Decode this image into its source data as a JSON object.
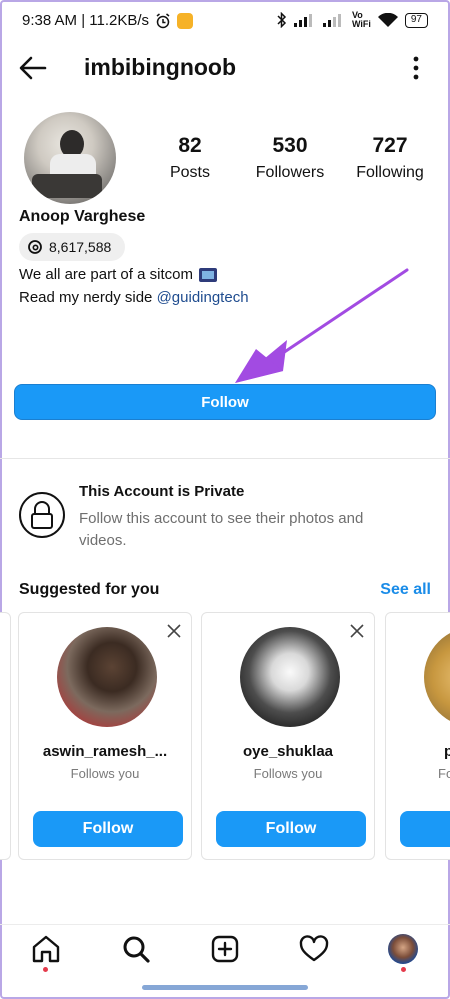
{
  "status_bar": {
    "time_speed": "9:38 AM | 11.2KB/s",
    "vo_top": "Vo",
    "vo_bottom": "WiFi",
    "battery": "97"
  },
  "header": {
    "username": "imbibingnoob"
  },
  "profile": {
    "stats": [
      {
        "value": "82",
        "label": "Posts"
      },
      {
        "value": "530",
        "label": "Followers"
      },
      {
        "value": "727",
        "label": "Following"
      }
    ],
    "full_name": "Anoop Varghese",
    "threads_count": "8,617,588",
    "bio_line1": "We all are part of a sitcom",
    "bio_line2_prefix": "Read my nerdy side",
    "bio_link": "@guidingtech",
    "follow_label": "Follow"
  },
  "private_notice": {
    "title": "This Account is Private",
    "description": "Follow this account to see their photos and videos."
  },
  "suggested": {
    "title": "Suggested for you",
    "see_all": "See all",
    "cards": [
      {
        "name": "aswin_ramesh_...",
        "subtitle": "Follows you",
        "button": "Follow"
      },
      {
        "name": "oye_shuklaa",
        "subtitle": "Follows you",
        "button": "Follow"
      },
      {
        "name": "p",
        "subtitle": "Fo",
        "button": ""
      }
    ]
  },
  "colors": {
    "accent_blue": "#1a99f7",
    "link_blue": "#1f4c8f",
    "arrow_purple": "#a24be2",
    "notification_dot": "#e43a4b"
  },
  "icons": [
    "back-arrow-icon",
    "more-vertical-icon",
    "threads-icon",
    "tv-emoji-icon",
    "lock-icon",
    "close-icon",
    "home-icon",
    "search-icon",
    "create-icon",
    "heart-icon",
    "profile-avatar-icon"
  ]
}
